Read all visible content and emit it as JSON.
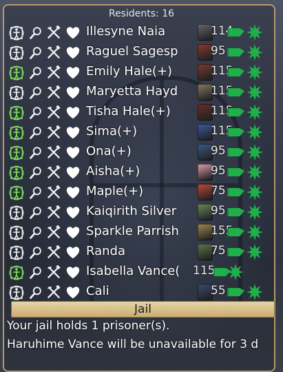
{
  "header": {
    "residents_label": "Residents: 16"
  },
  "residents": [
    {
      "name": "Illesyne Naia",
      "value": "114",
      "active": false,
      "portrait_color": "#6a6470"
    },
    {
      "name": "Raguel Sagesp",
      "value": "95",
      "active": false,
      "portrait_color": "#8a3a2e"
    },
    {
      "name": "Emily Hale(+)",
      "value": "115",
      "active": true,
      "portrait_color": "#7a3a30"
    },
    {
      "name": "Maryetta Hayd",
      "value": "115",
      "active": false,
      "portrait_color": "#8a7a60"
    },
    {
      "name": "Tisha Hale(+)",
      "value": "115",
      "active": true,
      "portrait_color": "#6a2e28"
    },
    {
      "name": "Sima(+)",
      "value": "115",
      "active": true,
      "portrait_color": "#3a5aa0"
    },
    {
      "name": "Ona(+)",
      "value": "95",
      "active": true,
      "portrait_color": "#3a5a8a"
    },
    {
      "name": "Aisha(+)",
      "value": "95",
      "active": true,
      "portrait_color": "#e0a0b0"
    },
    {
      "name": "Maple(+)",
      "value": "75",
      "active": true,
      "portrait_color": "#c04a3a"
    },
    {
      "name": "Kaiqirith Silver",
      "value": "95",
      "active": false,
      "portrait_color": "#6a8a5a"
    },
    {
      "name": "Sparkle Parrish",
      "value": "155",
      "active": false,
      "portrait_color": "#a08a50"
    },
    {
      "name": "Randa",
      "value": "75",
      "active": false,
      "portrait_color": "#5a7a4a"
    },
    {
      "name": "Isabella Vance(",
      "value": "115",
      "active": true,
      "portrait_color": ""
    },
    {
      "name": "Cali",
      "value": "55",
      "active": false,
      "portrait_color": "#3a4a70"
    }
  ],
  "jail": {
    "button_label": "Jail",
    "status_line": "Your jail holds 1 prisoner(s).",
    "detail_line": "Haruhime Vance will be unavailable for 3 d"
  },
  "colors": {
    "active_icon": "#7ee05a",
    "inactive_icon": "#f2f2f2",
    "accent_green": "#1fb04a",
    "border_gold": "#b79a6a"
  },
  "icons": [
    "body-icon",
    "magnifier-icon",
    "tools-icon",
    "heart-icon",
    "flag-icon",
    "star-icon"
  ]
}
